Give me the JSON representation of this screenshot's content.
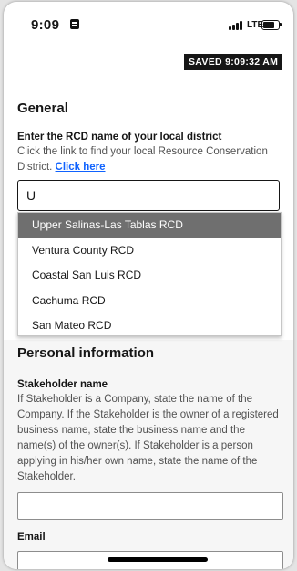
{
  "status_bar": {
    "time": "9:09",
    "network": "LTE",
    "battery_level": 0.75
  },
  "saved_badge": "SAVED 9:09:32 AM",
  "general": {
    "title": "General",
    "rcd_label": "Enter the RCD name of your local district",
    "rcd_helper": "Click the link to find your local Resource Conservation District. ",
    "rcd_link": "Click here",
    "rcd_input_value": "U",
    "rcd_options": [
      "Upper Salinas-Las Tablas RCD",
      "Ventura County RCD",
      "Coastal San Luis RCD",
      "Cachuma RCD",
      "San Mateo RCD"
    ],
    "highlighted_option": "Upper Salinas-Las Tablas RCD"
  },
  "personal": {
    "title": "Personal information",
    "stakeholder_label": "Stakeholder name",
    "stakeholder_helper": "If Stakeholder is a Company, state the name of the Company. If the Stakeholder is the owner of a registered business name, state the business name and the name(s) of the owner(s). If Stakeholder is a person applying in his/her own name, state the name of the Stakeholder.",
    "stakeholder_value": "",
    "email_label": "Email",
    "email_value": ""
  },
  "colors": {
    "accent": "#0f62fe",
    "selected_option": "#6f6f6f",
    "badge": "#161616"
  },
  "icons": [
    "alarm-icon",
    "signal-icon",
    "battery-icon"
  ]
}
